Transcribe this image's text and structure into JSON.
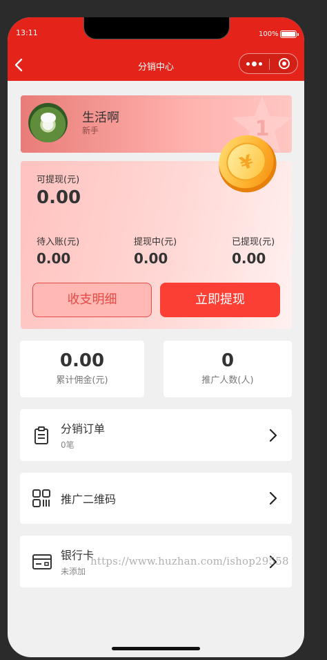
{
  "status_bar": {
    "time": "13:11",
    "battery": "100%"
  },
  "nav": {
    "title": "分销中心"
  },
  "profile": {
    "name": "生活啊",
    "level": "新手",
    "badge_number": "1"
  },
  "balance": {
    "withdrawable_label": "可提现(元)",
    "withdrawable_value": "0.00",
    "pending_label": "待入账(元)",
    "pending_value": "0.00",
    "withdrawing_label": "提现中(元)",
    "withdrawing_value": "0.00",
    "withdrawn_label": "已提现(元)",
    "withdrawn_value": "0.00",
    "detail_button": "收支明细",
    "withdraw_button": "立即提现"
  },
  "summary": {
    "commission_value": "0.00",
    "commission_label": "累计佣金(元)",
    "promoters_value": "0",
    "promoters_label": "推广人数(人)"
  },
  "menu": {
    "orders_title": "分销订单",
    "orders_sub": "0笔",
    "qrcode_title": "推广二维码",
    "bank_title": "银行卡",
    "bank_sub": "未添加"
  },
  "watermark": "https://www.huzhan.com/ishop29558",
  "colors": {
    "brand_red": "#e4231a",
    "button_red": "#fc3f34",
    "card_pink": "#ffc2bf"
  },
  "icons": [
    "back-icon",
    "more-dots-icon",
    "close-circle-icon",
    "star-badge-icon",
    "coin-icon",
    "clipboard-icon",
    "qrcode-icon",
    "bank-card-icon",
    "chevron-right-icon"
  ]
}
